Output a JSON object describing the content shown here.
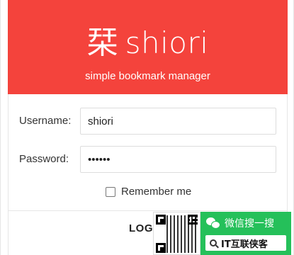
{
  "header": {
    "logo_glyph": "栞",
    "app_name": "shiori",
    "tagline": "simple bookmark manager",
    "background": "#f4433c"
  },
  "form": {
    "username_label": "Username:",
    "username_value": "shiori",
    "password_label": "Password:",
    "password_value": "••••••",
    "remember_label": "Remember me",
    "remember_checked": false,
    "login_label": "LOG"
  },
  "watermark": {
    "wechat_search_label": "微信搜一搜",
    "account_name": "IT互联侠客",
    "accent": "#25c05a"
  }
}
